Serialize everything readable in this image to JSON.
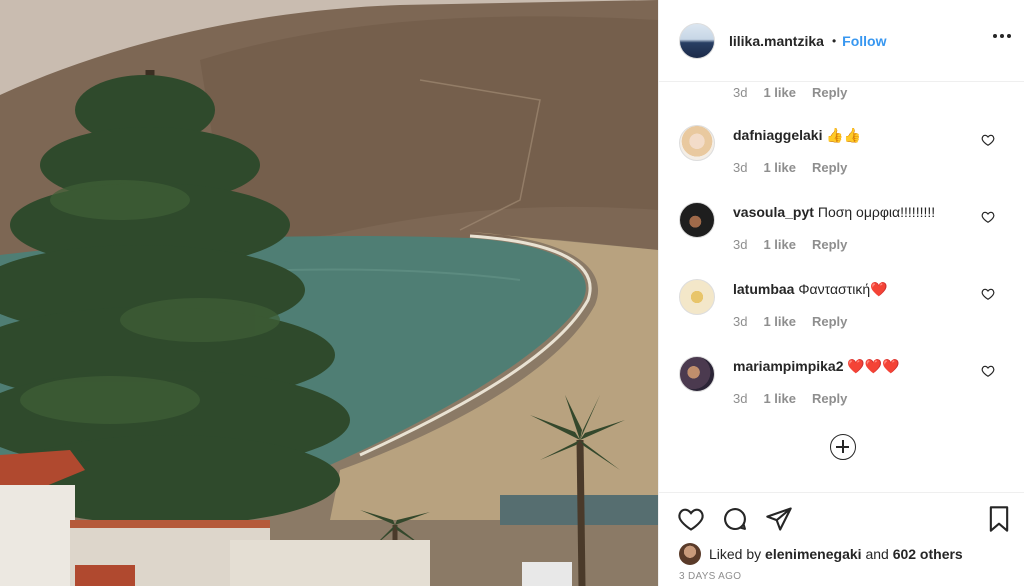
{
  "post": {
    "username": "lilika.mantzika",
    "separator": "•",
    "follow_label": "Follow",
    "more_icon": "more-horizontal-icon"
  },
  "first_meta": {
    "time": "3d",
    "likes": "1 like",
    "reply": "Reply"
  },
  "comments": [
    {
      "username": "dafniaggelaki",
      "text": "👍👍",
      "time": "3d",
      "likes": "1 like",
      "reply": "Reply"
    },
    {
      "username": "vasoula_pyt",
      "text": "Ποση ομρφια!!!!!!!!!",
      "time": "3d",
      "likes": "1 like",
      "reply": "Reply"
    },
    {
      "username": "latumbaa",
      "text": "Φανταστική❤️",
      "time": "3d",
      "likes": "1 like",
      "reply": "Reply"
    },
    {
      "username": "mariampimpika2",
      "text": "❤️❤️❤️",
      "time": "3d",
      "likes": "1 like",
      "reply": "Reply"
    }
  ],
  "footer": {
    "liked_by_prefix": "Liked by",
    "liked_by_user": "elenimenegaki",
    "liked_by_and": "and",
    "others": "602 others",
    "date": "3 DAYS AGO"
  },
  "colors": {
    "accent": "#3897f0",
    "text": "#262626",
    "muted": "#8e8e8e",
    "border": "#efefef"
  }
}
